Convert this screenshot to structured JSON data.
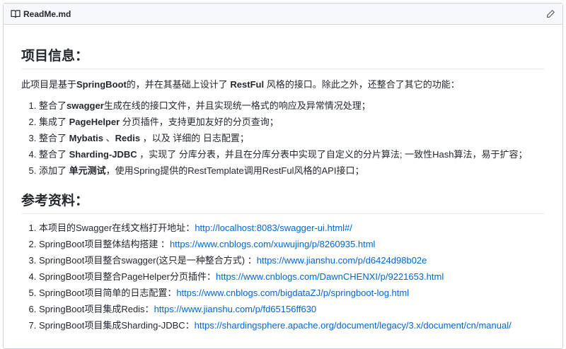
{
  "file": {
    "name": "ReadMe.md"
  },
  "sections": {
    "info_title": "项目信息：",
    "intro": [
      {
        "t": "此项目是基于"
      },
      {
        "t": "SpringBoot",
        "b": true
      },
      {
        "t": "的，并在其基础上设计了 "
      },
      {
        "t": "RestFul",
        "b": true
      },
      {
        "t": " 风格的接口。除此之外，还整合了其它的功能："
      }
    ],
    "features": [
      [
        {
          "t": "整合了"
        },
        {
          "t": "swagger",
          "b": true
        },
        {
          "t": "生成在线的接口文件，并且实现统一格式的响应及异常情况处理；"
        }
      ],
      [
        {
          "t": "集成了 "
        },
        {
          "t": "PageHelper",
          "b": true
        },
        {
          "t": " 分页插件，支持更加友好的分页查询；"
        }
      ],
      [
        {
          "t": "整合了 "
        },
        {
          "t": "Mybatis",
          "b": true
        },
        {
          "t": " 、"
        },
        {
          "t": "Redis",
          "b": true
        },
        {
          "t": " ，以及 详细的 日志配置；"
        }
      ],
      [
        {
          "t": "整合了 "
        },
        {
          "t": "Sharding-JDBC",
          "b": true
        },
        {
          "t": " ，实现了 分库分表，并且在分库分表中实现了自定义的分片算法; 一致性Hash算法，易于扩容；"
        }
      ],
      [
        {
          "t": "添加了 "
        },
        {
          "t": "单元测试",
          "b": true
        },
        {
          "t": "，使用Spring提供的RestTemplate调用RestFul风格的API接口；"
        }
      ]
    ],
    "refs_title": "参考资料：",
    "refs": [
      {
        "label": "本项目的Swagger在线文档打开地址：",
        "url": "http://localhost:8083/swagger-ui.html#/"
      },
      {
        "label": "SpringBoot项目整体结构搭建 ：",
        "url": "https://www.cnblogs.com/xuwujing/p/8260935.html"
      },
      {
        "label": "SpringBoot项目整合swagger(这只是一种整合方式) ：",
        "url": "https://www.jianshu.com/p/d6424d98b02e"
      },
      {
        "label": "SpringBoot项目整合PageHelper分页插件：",
        "url": "https://www.cnblogs.com/DawnCHENXI/p/9221653.html"
      },
      {
        "label": "SpringBoot项目简单的日志配置：",
        "url": "https://www.cnblogs.com/bigdataZJ/p/springboot-log.html"
      },
      {
        "label": "SpringBoot项目集成Redis：",
        "url": "https://www.jianshu.com/p/fd65156ff630"
      },
      {
        "label": "SpringBoot项目集成Sharding-JDBC：",
        "url": "https://shardingsphere.apache.org/document/legacy/3.x/document/cn/manual/"
      }
    ]
  }
}
